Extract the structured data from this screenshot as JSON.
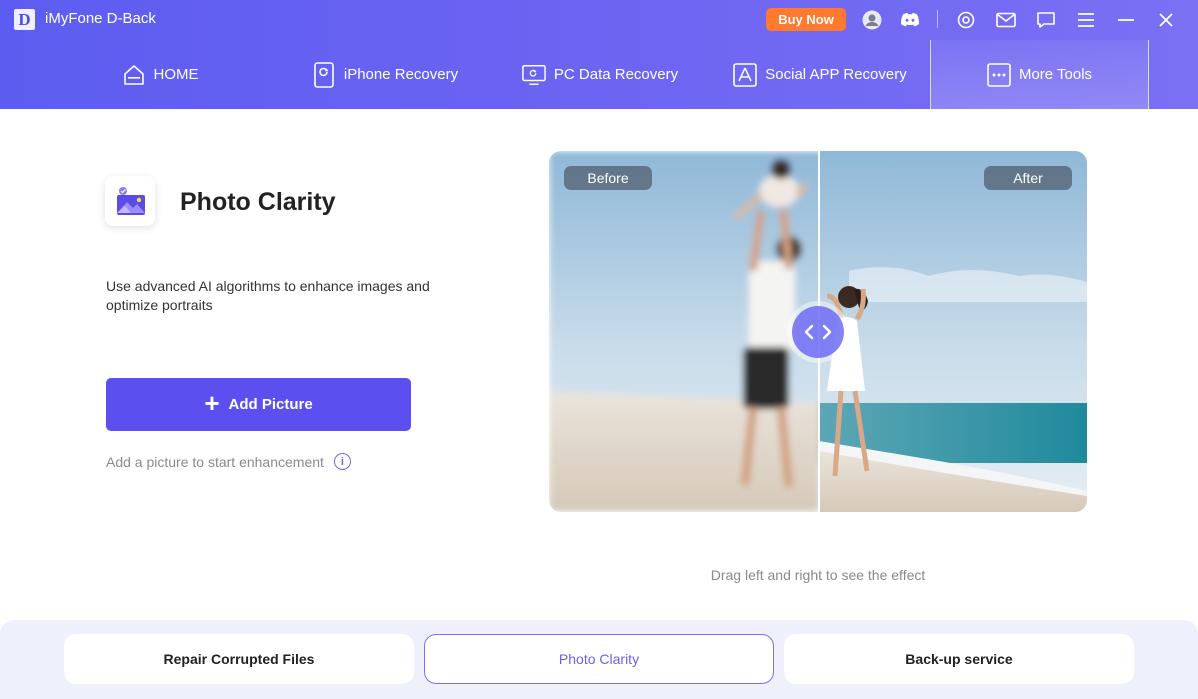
{
  "app": {
    "logo_letter": "D",
    "title": "iMyFone D-Back"
  },
  "titlebar": {
    "buy_now": "Buy Now",
    "icons": [
      "user-icon",
      "discord-icon",
      "settings-icon",
      "mail-icon",
      "chat-icon",
      "menu-icon",
      "minimize-icon",
      "close-icon"
    ]
  },
  "nav": {
    "items": [
      {
        "label": "HOME",
        "icon": "home-icon"
      },
      {
        "label": "iPhone Recovery",
        "icon": "iphone-icon"
      },
      {
        "label": "PC Data Recovery",
        "icon": "pc-icon"
      },
      {
        "label": "Social APP Recovery",
        "icon": "app-store-icon"
      },
      {
        "label": "More Tools",
        "icon": "more-tools-icon",
        "active": true
      }
    ]
  },
  "feature": {
    "title": "Photo Clarity",
    "description": "Use advanced AI algorithms to enhance images and optimize portraits",
    "add_button": "Add Picture",
    "hint": "Add a picture to start enhancement"
  },
  "compare": {
    "before_label": "Before",
    "after_label": "After",
    "drag_hint": "Drag left and right to see the effect"
  },
  "bottom_tabs": [
    {
      "label": "Repair Corrupted Files",
      "active": false
    },
    {
      "label": "Photo Clarity",
      "active": true
    },
    {
      "label": "Back-up service",
      "active": false
    }
  ],
  "colors": {
    "accent": "#5b4ff0",
    "header": "#6b63f2",
    "buy_now": "#ff7a2e"
  }
}
